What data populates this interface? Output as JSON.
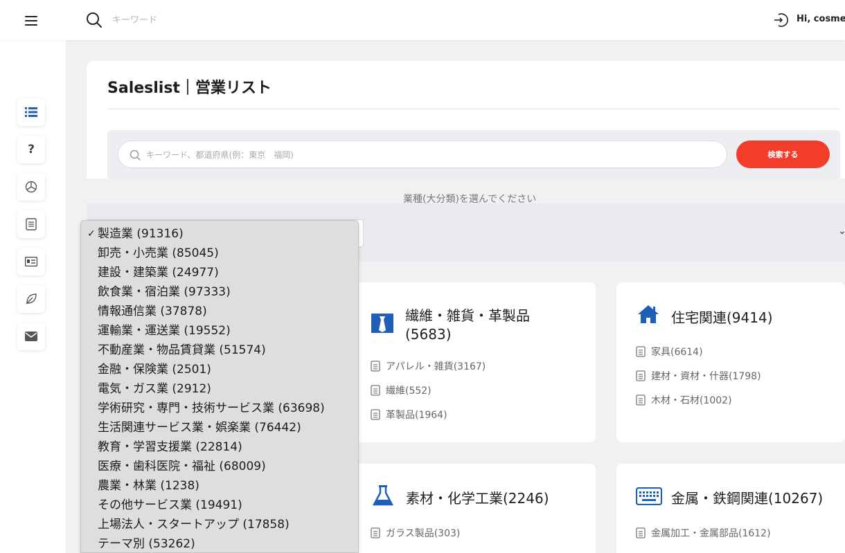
{
  "topbar": {
    "search_placeholder": "キーワード",
    "greeting": "Hi,  cosmex"
  },
  "page": {
    "title": "Saleslist｜営業リスト",
    "search_placeholder": "キーワード、都道府県(例：東京　福岡)",
    "search_button": "検索する",
    "industry_prompt": "業種(大分類)を選んでください"
  },
  "dropdown": {
    "selected_index": 0,
    "options": [
      "製造業 (91316)",
      "卸売・小売業 (85045)",
      "建設・建築業 (24977)",
      "飲食業・宿泊業 (97333)",
      "情報通信業 (37878)",
      "運輸業・運送業 (19552)",
      "不動産業・物品賃貸業 (51574)",
      "金融・保険業 (2501)",
      "電気・ガス業 (2912)",
      "学術研究・専門・技術サービス業 (63698)",
      "生活関連サービス業・娯楽業 (76442)",
      "教育・学習支援業 (22814)",
      "医療・歯科医院・福祉 (68009)",
      "農業・林業 (1238)",
      "その他サービス業 (19491)",
      "上場法人・スタートアップ (17858)",
      "テーマ別 (53262)"
    ]
  },
  "categories": [
    {
      "icon": "tie-icon",
      "title_line1": "繊維・雑貨・革製品",
      "title_line2": "(5683)",
      "items": [
        "アパレル・雑貨(3167)",
        "繊維(552)",
        "革製品(1964)"
      ]
    },
    {
      "icon": "home-icon",
      "title": "住宅関連(9414)",
      "items": [
        "家具(6614)",
        "建材・資材・什器(1798)",
        "木材・石材(1002)"
      ]
    },
    {
      "icon": "flask-icon",
      "title": "素材・化学工業(2246)",
      "items": [
        "ガラス製品(303)"
      ]
    },
    {
      "icon": "keyboard-icon",
      "title": "金属・鉄鋼関連(10267)",
      "items": [
        "金属加工・金属部品(1612)"
      ]
    }
  ],
  "colors": {
    "accent_red": "#f23d2b",
    "icon_blue": "#1f5fb8"
  }
}
